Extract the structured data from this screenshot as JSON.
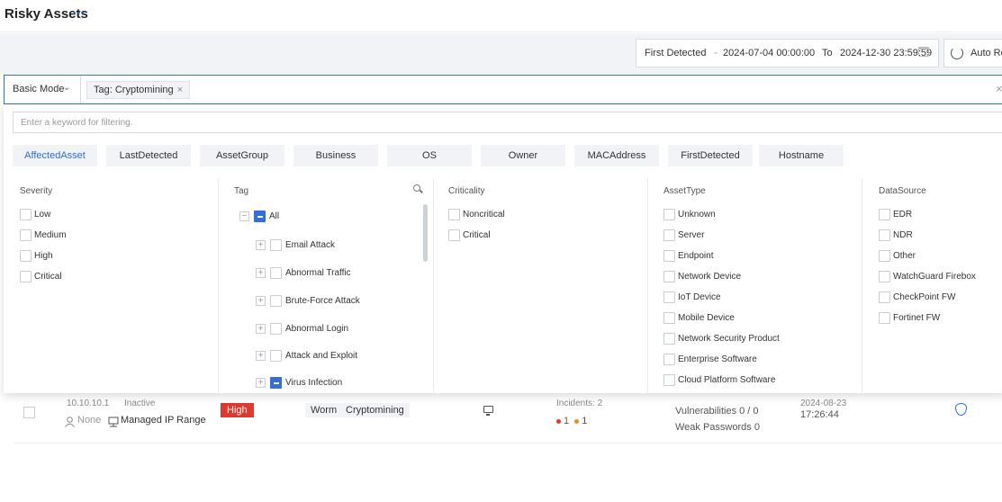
{
  "header": {
    "title": "Risky Assets",
    "more": "···"
  },
  "date_filter": {
    "field": "First Detected",
    "start": "2024-07-04 00:00:00",
    "to_label": "To",
    "end": "2024-12-30 23:59:59"
  },
  "auto_refresh": {
    "label": "Auto Ref"
  },
  "filter_bar": {
    "mode": "Basic Mode",
    "tag_chip": "Tag: Cryptomining",
    "chip_close": "×",
    "clear": "×"
  },
  "panel": {
    "search_placeholder": "Enter a keyword for filtering.",
    "fields": [
      "AffectedAsset",
      "LastDetected",
      "AssetGroup",
      "Business",
      "OS",
      "Owner",
      "MACAddress",
      "FirstDetected",
      "Hostname"
    ],
    "severity": {
      "title": "Severity",
      "options": [
        "Low",
        "Medium",
        "High",
        "Critical"
      ]
    },
    "tag": {
      "title": "Tag",
      "all_label": "All",
      "items": [
        "Email Attack",
        "Abnormal Traffic",
        "Brute-Force Attack",
        "Abnormal Login",
        "Attack and Exploit",
        "Virus Infection"
      ]
    },
    "criticality": {
      "title": "Criticality",
      "options": [
        "Noncritical",
        "Critical"
      ]
    },
    "asset_type": {
      "title": "AssetType",
      "options": [
        "Unknown",
        "Server",
        "Endpoint",
        "Network Device",
        "IoT Device",
        "Mobile Device",
        "Network Security Product",
        "Enterprise Software",
        "Cloud Platform Software"
      ]
    },
    "data_source": {
      "title": "DataSource",
      "options": [
        "EDR",
        "NDR",
        "Other",
        "WatchGuard Firebox",
        "CheckPoint FW",
        "Fortinet FW"
      ]
    }
  },
  "row": {
    "name_partial": "10.10.10.1",
    "status_partial": "Inactive",
    "owner": "None",
    "group": "Managed IP Range",
    "severity": "High",
    "tags": [
      "Worm",
      "Cryptomining"
    ],
    "incident_partial": "Incidents: 2",
    "counts": [
      "1",
      "1"
    ],
    "vulnerabilities": "Vulnerabilities 0 / 0",
    "weak_passwords": "Weak Passwords 0",
    "date_partial": "2024-08-23",
    "time": "17:26:44"
  },
  "colors": {
    "accent": "#2f6fd6",
    "high": "#e0392f",
    "dot_red": "#e0392f",
    "dot_orange": "#f08a24"
  }
}
